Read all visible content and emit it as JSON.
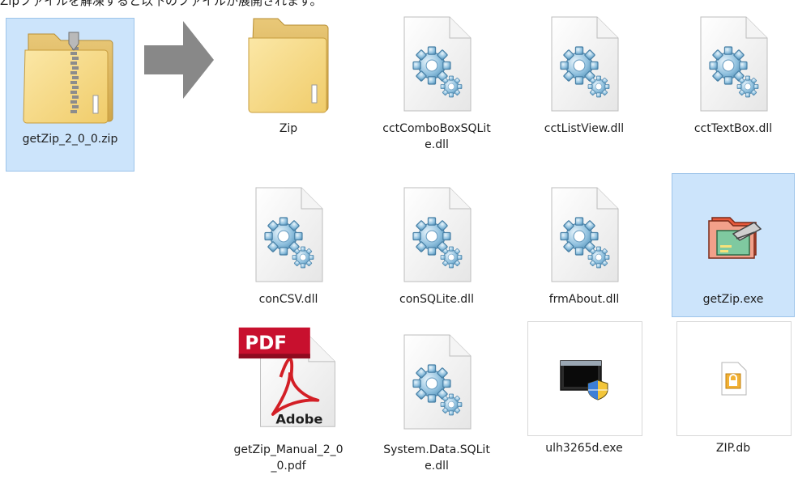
{
  "caption": "Zipファイルを解凍すると以下のファイルが展開されます。",
  "source_file": {
    "name": "getZip_2_0_0.zip",
    "icon": "zip-folder-icon"
  },
  "arrow_icon": "arrow-right-icon",
  "files": [
    {
      "name": "Zip",
      "icon": "folder-icon"
    },
    {
      "name": "cctComboBoxSQLite.dll",
      "icon": "dll-gear-icon"
    },
    {
      "name": "cctListView.dll",
      "icon": "dll-gear-icon"
    },
    {
      "name": "cctTextBox.dll",
      "icon": "dll-gear-icon"
    },
    {
      "name": "conCSV.dll",
      "icon": "dll-gear-icon"
    },
    {
      "name": "conSQLite.dll",
      "icon": "dll-gear-icon"
    },
    {
      "name": "frmAbout.dll",
      "icon": "dll-gear-icon"
    },
    {
      "name": "getZip.exe",
      "icon": "getzip-app-icon",
      "selected": true
    },
    {
      "name": "getZip_Manual_2_0_0.pdf",
      "icon": "pdf-icon",
      "badge": "PDF",
      "brand": "Adobe"
    },
    {
      "name": "System.Data.SQLite.dll",
      "icon": "dll-gear-icon"
    },
    {
      "name": "ulh3265d.exe",
      "icon": "exe-window-icon"
    },
    {
      "name": "ZIP.db",
      "icon": "db-locked-icon"
    }
  ]
}
